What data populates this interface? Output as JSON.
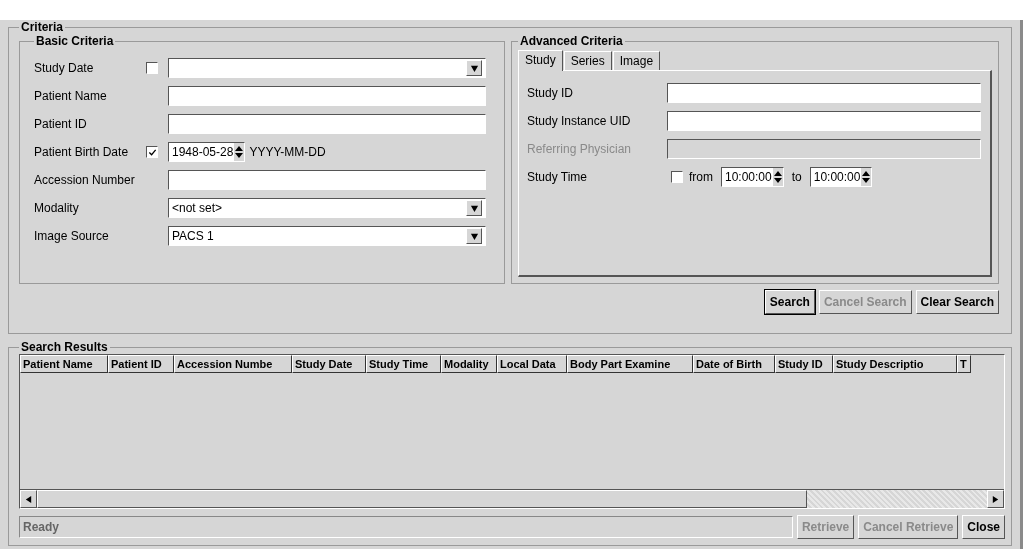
{
  "criteria": {
    "title": "Criteria",
    "basic": {
      "title": "Basic Criteria",
      "fields": [
        {
          "kind": "combo",
          "label": "Study Date",
          "checked": false
        },
        {
          "kind": "text",
          "label": "Patient Name"
        },
        {
          "kind": "text",
          "label": "Patient ID"
        },
        {
          "kind": "date",
          "label": "Patient Birth Date",
          "checked": true,
          "value": "1948-05-28",
          "hint": "YYYY-MM-DD"
        },
        {
          "kind": "text",
          "label": "Accession Number"
        },
        {
          "kind": "combo",
          "label": "Modality",
          "value": "<not set>"
        },
        {
          "kind": "combo",
          "label": "Image Source",
          "value": "PACS 1"
        }
      ]
    },
    "advanced": {
      "title": "Advanced Criteria",
      "tabs": [
        {
          "label": "Study",
          "selected": true
        },
        {
          "label": "Series",
          "selected": false
        },
        {
          "label": "Image",
          "selected": false
        }
      ],
      "fields": [
        {
          "kind": "text",
          "label": "Study ID",
          "disabled": false
        },
        {
          "kind": "text",
          "label": "Study Instance UID",
          "disabled": false
        },
        {
          "kind": "text",
          "label": "Referring Physician",
          "disabled": true
        },
        {
          "kind": "time",
          "label": "Study Time",
          "disabled": false,
          "checked": false,
          "from_label": "from",
          "from": "10:00:00",
          "to_label": "to",
          "to": "10:00:00"
        }
      ]
    },
    "buttons": [
      {
        "label": "Search",
        "disabled": false,
        "default": true
      },
      {
        "label": "Cancel Search",
        "disabled": true,
        "default": false
      },
      {
        "label": "Clear Search",
        "disabled": false,
        "default": false
      }
    ]
  },
  "results": {
    "title": "Search Results",
    "columns": [
      "Patient Name",
      "Patient ID",
      "Accession Numbe",
      "Study Date",
      "Study Time",
      "Modality",
      "Local Data",
      "Body Part Examine",
      "Date of Birth",
      "Study ID",
      "Study Descriptio",
      "T"
    ],
    "status": "Ready",
    "buttons": [
      {
        "label": "Retrieve",
        "disabled": true
      },
      {
        "label": "Cancel Retrieve",
        "disabled": true
      },
      {
        "label": "Close",
        "disabled": false
      }
    ]
  }
}
